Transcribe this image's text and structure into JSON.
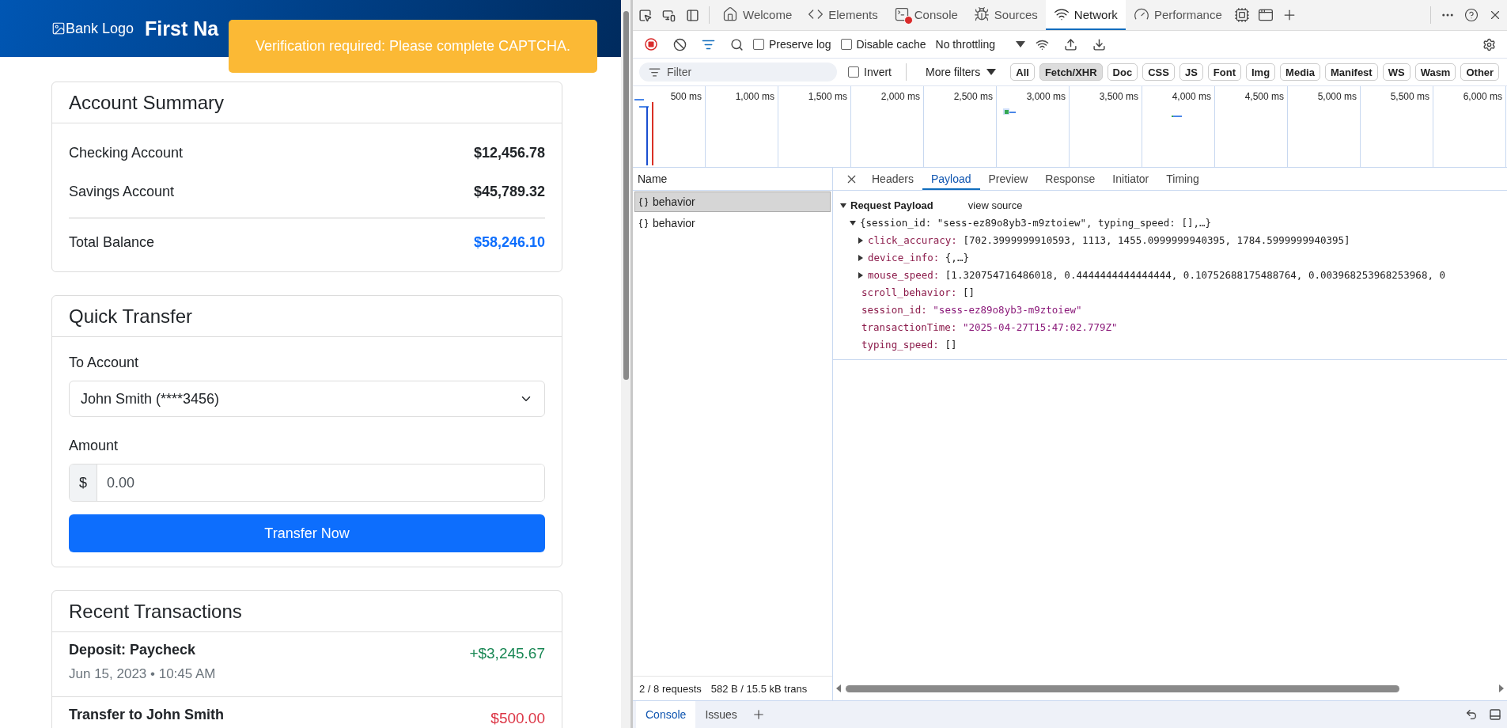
{
  "bank_page": {
    "logo_alt": "Bank Logo",
    "title": "First Na",
    "toast": {
      "message": "Verification required: Please complete CAPTCHA."
    },
    "account_summary": {
      "title": "Account Summary",
      "accounts": [
        {
          "name": "Checking Account",
          "balance": "$12,456.78"
        },
        {
          "name": "Savings Account",
          "balance": "$45,789.32"
        }
      ],
      "total": {
        "label": "Total Balance",
        "amount": "$58,246.10"
      }
    },
    "quick_transfer": {
      "title": "Quick Transfer",
      "to_label": "To Account",
      "to_value": "John Smith (****3456)",
      "amount_label": "Amount",
      "currency": "$",
      "amount_placeholder": "0.00",
      "button": "Transfer Now"
    },
    "recent_transactions": {
      "title": "Recent Transactions",
      "items": [
        {
          "title": "Deposit: Paycheck",
          "date": "Jun 15, 2023 • 10:45 AM",
          "amount": "+$3,245.67",
          "kind": "credit"
        },
        {
          "title": "Transfer to John Smith",
          "amount": "$500.00",
          "kind": "debit"
        }
      ]
    }
  },
  "devtools": {
    "tabs": [
      {
        "label": "Welcome",
        "selected": false
      },
      {
        "label": "Elements",
        "selected": false
      },
      {
        "label": "Console",
        "selected": false,
        "error_badge": true
      },
      {
        "label": "Sources",
        "selected": false
      },
      {
        "label": "Network",
        "selected": true
      },
      {
        "label": "Performance",
        "selected": false
      }
    ],
    "toolbar": {
      "recording": true,
      "preserve_log": {
        "label": "Preserve log",
        "checked": false
      },
      "disable_cache": {
        "label": "Disable cache",
        "checked": false
      },
      "throttling": "No throttling"
    },
    "filter_bar": {
      "placeholder": "Filter",
      "invert": {
        "label": "Invert",
        "checked": false
      },
      "more_filters": "More filters",
      "types": [
        {
          "label": "All",
          "selected": false
        },
        {
          "label": "Fetch/XHR",
          "selected": true
        },
        {
          "label": "Doc",
          "selected": false
        },
        {
          "label": "CSS",
          "selected": false
        },
        {
          "label": "JS",
          "selected": false
        },
        {
          "label": "Font",
          "selected": false
        },
        {
          "label": "Img",
          "selected": false
        },
        {
          "label": "Media",
          "selected": false
        },
        {
          "label": "Manifest",
          "selected": false
        },
        {
          "label": "WS",
          "selected": false
        },
        {
          "label": "Wasm",
          "selected": false
        },
        {
          "label": "Other",
          "selected": false
        }
      ]
    },
    "timeline": {
      "ticks": [
        "500 ms",
        "1,000 ms",
        "1,500 ms",
        "2,000 ms",
        "2,500 ms",
        "3,000 ms",
        "3,500 ms",
        "4,000 ms",
        "4,500 ms",
        "5,000 ms",
        "5,500 ms",
        "6,000 ms"
      ]
    },
    "requests": {
      "column": "Name",
      "rows": [
        {
          "name": "behavior",
          "selected": true
        },
        {
          "name": "behavior",
          "selected": false
        }
      ],
      "status": [
        "2 / 8 requests",
        "582 B / 15.5 kB trans"
      ]
    },
    "details": {
      "tabs": [
        {
          "label": "Headers",
          "selected": false
        },
        {
          "label": "Payload",
          "selected": true
        },
        {
          "label": "Preview",
          "selected": false
        },
        {
          "label": "Response",
          "selected": false
        },
        {
          "label": "Initiator",
          "selected": false
        },
        {
          "label": "Timing",
          "selected": false
        }
      ],
      "payload": {
        "title": "Request Payload",
        "expanded": true,
        "view_source": "view source",
        "root": {
          "summary": "{session_id: \"sess-ez89o8yb3-m9ztoiew\", typing_speed: [],…}",
          "expanded": true,
          "children": [
            {
              "key": "click_accuracy:",
              "value": "[702.3999999910593, 1113, 1455.0999999940395, 1784.5999999940395]",
              "kind": "object",
              "expanded": false
            },
            {
              "key": "device_info:",
              "value": "{,…}",
              "kind": "object",
              "expanded": false
            },
            {
              "key": "mouse_speed:",
              "value": "[1.320754716486018, 0.4444444444444444, 0.10752688175488764, 0.003968253968253968, 0",
              "kind": "object",
              "expanded": false
            },
            {
              "key": "scroll_behavior:",
              "value": "[]",
              "kind": "literal"
            },
            {
              "key": "session_id:",
              "value": "\"sess-ez89o8yb3-m9ztoiew\"",
              "kind": "string"
            },
            {
              "key": "transactionTime:",
              "value": "\"2025-04-27T15:47:02.779Z\"",
              "kind": "string"
            },
            {
              "key": "typing_speed:",
              "value": "[]",
              "kind": "literal"
            }
          ]
        }
      }
    },
    "drawer": {
      "tabs": [
        {
          "label": "Console",
          "selected": true
        },
        {
          "label": "Issues",
          "selected": false
        }
      ]
    }
  }
}
